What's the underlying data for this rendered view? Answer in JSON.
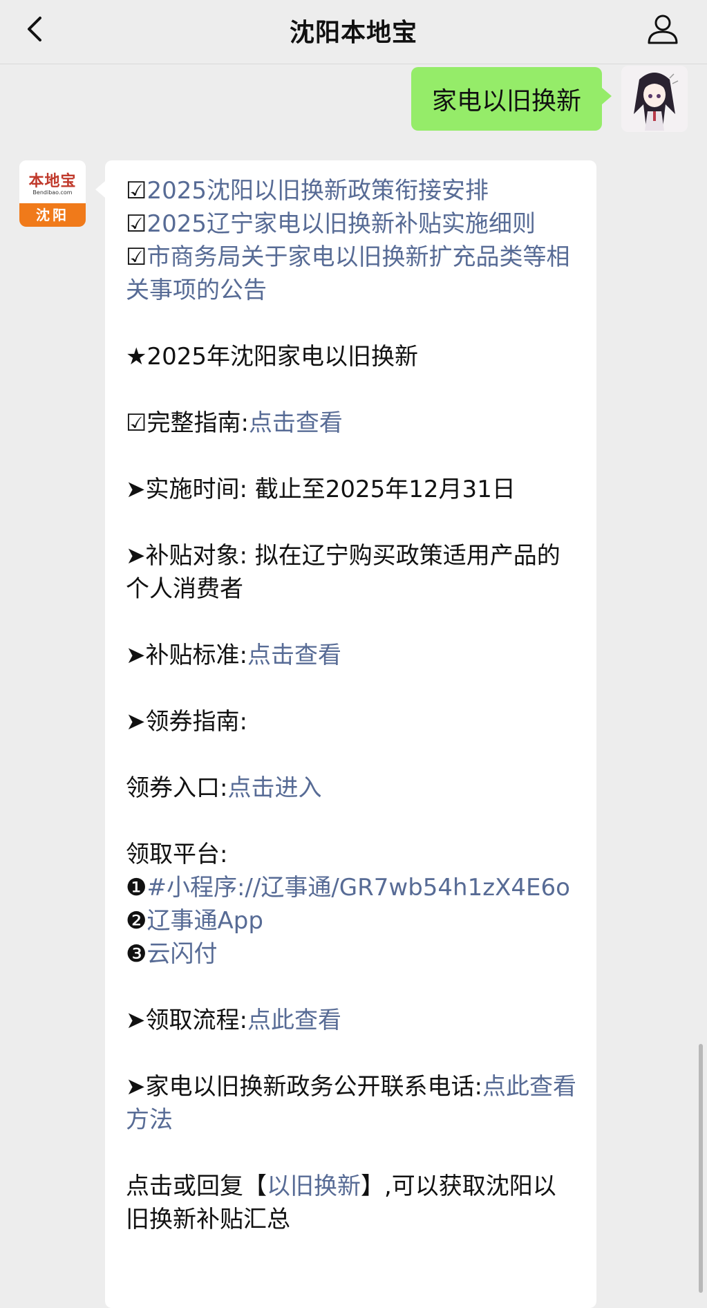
{
  "header": {
    "title": "沈阳本地宝"
  },
  "outgoing": {
    "text": "家电以旧换新"
  },
  "bot_avatar": {
    "brand": "本地宝",
    "domain": "Bendibao.com",
    "city": "沈阳"
  },
  "message": {
    "links_top": [
      {
        "prefix": "☑",
        "text": "2025沈阳以旧换新政策衔接安排"
      },
      {
        "prefix": "☑",
        "text": "2025辽宁家电以旧换新补贴实施细则"
      },
      {
        "prefix": "☑",
        "text": "市商务局关于家电以旧换新扩充品类等相关事项的公告"
      }
    ],
    "section_title": "★2025年沈阳家电以旧换新",
    "guide_label": "☑完整指南:",
    "guide_link": "点击查看",
    "time_label": "➤实施时间:",
    "time_value": "截止至2025年12月31日",
    "target_label": "➤补贴对象:",
    "target_value": "拟在辽宁购买政策适用产品的个人消费者",
    "standard_label": "➤补贴标准:",
    "standard_link": "点击查看",
    "coupon_guide_label": "➤领券指南:",
    "coupon_entry_label": "领券入口:",
    "coupon_entry_link": "点击进入",
    "platform_label": "领取平台:",
    "platforms": [
      {
        "num": "❶",
        "text": "#小程序://辽事通/GR7wb54h1zX4E6o"
      },
      {
        "num": "❷",
        "text": "辽事通App"
      },
      {
        "num": "❸",
        "text": "云闪付"
      }
    ],
    "process_label": "➤领取流程:",
    "process_link": "点此查看",
    "phone_label": "➤家电以旧换新政务公开联系电话:",
    "phone_link": "点此查看方法",
    "footer_prefix": "点击或回复【",
    "footer_link": "以旧换新",
    "footer_suffix": "】,可以获取沈阳以旧换新补贴汇总"
  },
  "colors": {
    "bubble_out": "#95ec69",
    "link": "#576b95",
    "background": "#ededed"
  }
}
